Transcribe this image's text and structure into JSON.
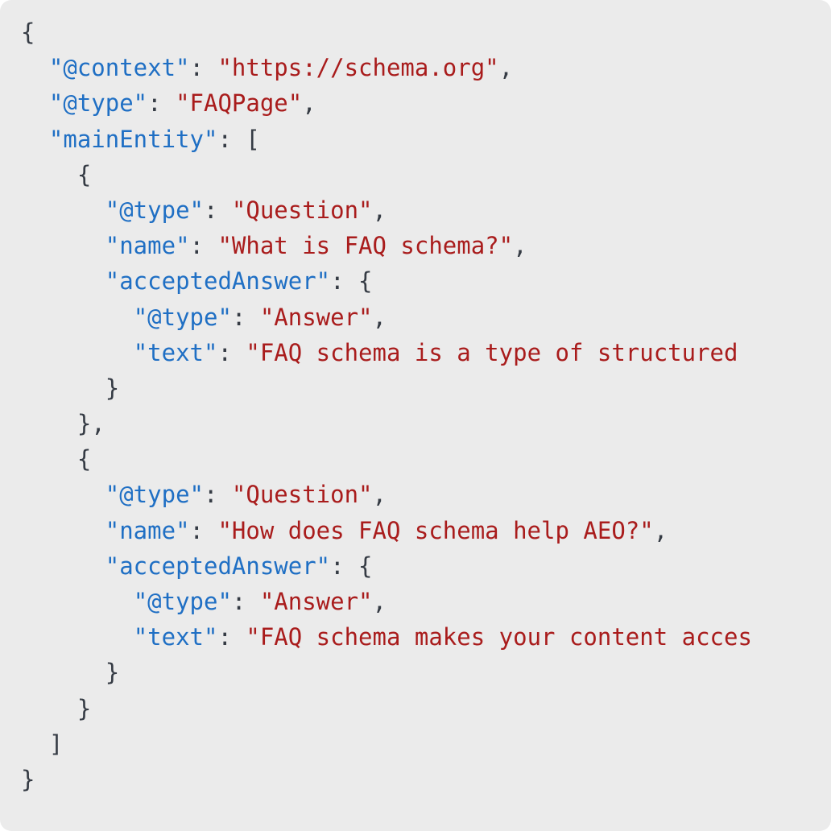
{
  "code_block": {
    "language": "json",
    "background_color": "#ebebeb",
    "key_color": "#1f6fc4",
    "string_color": "#a91c1c",
    "punctuation_color": "#353b44",
    "corner_radius_px": 14,
    "clipped_right_edge": true,
    "lines": [
      {
        "indent": 0,
        "tokens": [
          {
            "type": "punc",
            "text": "{"
          }
        ]
      },
      {
        "indent": 1,
        "tokens": [
          {
            "type": "key",
            "text": "\"@context\""
          },
          {
            "type": "punc",
            "text": ": "
          },
          {
            "type": "string",
            "text": "\"https://schema.org\""
          },
          {
            "type": "punc",
            "text": ","
          }
        ]
      },
      {
        "indent": 1,
        "tokens": [
          {
            "type": "key",
            "text": "\"@type\""
          },
          {
            "type": "punc",
            "text": ": "
          },
          {
            "type": "string",
            "text": "\"FAQPage\""
          },
          {
            "type": "punc",
            "text": ","
          }
        ]
      },
      {
        "indent": 1,
        "tokens": [
          {
            "type": "key",
            "text": "\"mainEntity\""
          },
          {
            "type": "punc",
            "text": ": ["
          }
        ]
      },
      {
        "indent": 2,
        "tokens": [
          {
            "type": "punc",
            "text": "{"
          }
        ]
      },
      {
        "indent": 3,
        "tokens": [
          {
            "type": "key",
            "text": "\"@type\""
          },
          {
            "type": "punc",
            "text": ": "
          },
          {
            "type": "string",
            "text": "\"Question\""
          },
          {
            "type": "punc",
            "text": ","
          }
        ]
      },
      {
        "indent": 3,
        "tokens": [
          {
            "type": "key",
            "text": "\"name\""
          },
          {
            "type": "punc",
            "text": ": "
          },
          {
            "type": "string",
            "text": "\"What is FAQ schema?\""
          },
          {
            "type": "punc",
            "text": ","
          }
        ]
      },
      {
        "indent": 3,
        "tokens": [
          {
            "type": "key",
            "text": "\"acceptedAnswer\""
          },
          {
            "type": "punc",
            "text": ": {"
          }
        ]
      },
      {
        "indent": 4,
        "tokens": [
          {
            "type": "key",
            "text": "\"@type\""
          },
          {
            "type": "punc",
            "text": ": "
          },
          {
            "type": "string",
            "text": "\"Answer\""
          },
          {
            "type": "punc",
            "text": ","
          }
        ]
      },
      {
        "indent": 4,
        "tokens": [
          {
            "type": "key",
            "text": "\"text\""
          },
          {
            "type": "punc",
            "text": ": "
          },
          {
            "type": "string",
            "text": "\"FAQ schema is a type of structured"
          }
        ]
      },
      {
        "indent": 3,
        "tokens": [
          {
            "type": "punc",
            "text": "}"
          }
        ]
      },
      {
        "indent": 2,
        "tokens": [
          {
            "type": "punc",
            "text": "},"
          }
        ]
      },
      {
        "indent": 2,
        "tokens": [
          {
            "type": "punc",
            "text": "{"
          }
        ]
      },
      {
        "indent": 3,
        "tokens": [
          {
            "type": "key",
            "text": "\"@type\""
          },
          {
            "type": "punc",
            "text": ": "
          },
          {
            "type": "string",
            "text": "\"Question\""
          },
          {
            "type": "punc",
            "text": ","
          }
        ]
      },
      {
        "indent": 3,
        "tokens": [
          {
            "type": "key",
            "text": "\"name\""
          },
          {
            "type": "punc",
            "text": ": "
          },
          {
            "type": "string",
            "text": "\"How does FAQ schema help AEO?\""
          },
          {
            "type": "punc",
            "text": ","
          }
        ]
      },
      {
        "indent": 3,
        "tokens": [
          {
            "type": "key",
            "text": "\"acceptedAnswer\""
          },
          {
            "type": "punc",
            "text": ": {"
          }
        ]
      },
      {
        "indent": 4,
        "tokens": [
          {
            "type": "key",
            "text": "\"@type\""
          },
          {
            "type": "punc",
            "text": ": "
          },
          {
            "type": "string",
            "text": "\"Answer\""
          },
          {
            "type": "punc",
            "text": ","
          }
        ]
      },
      {
        "indent": 4,
        "tokens": [
          {
            "type": "key",
            "text": "\"text\""
          },
          {
            "type": "punc",
            "text": ": "
          },
          {
            "type": "string",
            "text": "\"FAQ schema makes your content acces"
          }
        ]
      },
      {
        "indent": 3,
        "tokens": [
          {
            "type": "punc",
            "text": "}"
          }
        ]
      },
      {
        "indent": 2,
        "tokens": [
          {
            "type": "punc",
            "text": "}"
          }
        ]
      },
      {
        "indent": 1,
        "tokens": [
          {
            "type": "punc",
            "text": "]"
          }
        ]
      },
      {
        "indent": 0,
        "tokens": [
          {
            "type": "punc",
            "text": "}"
          }
        ]
      }
    ]
  }
}
